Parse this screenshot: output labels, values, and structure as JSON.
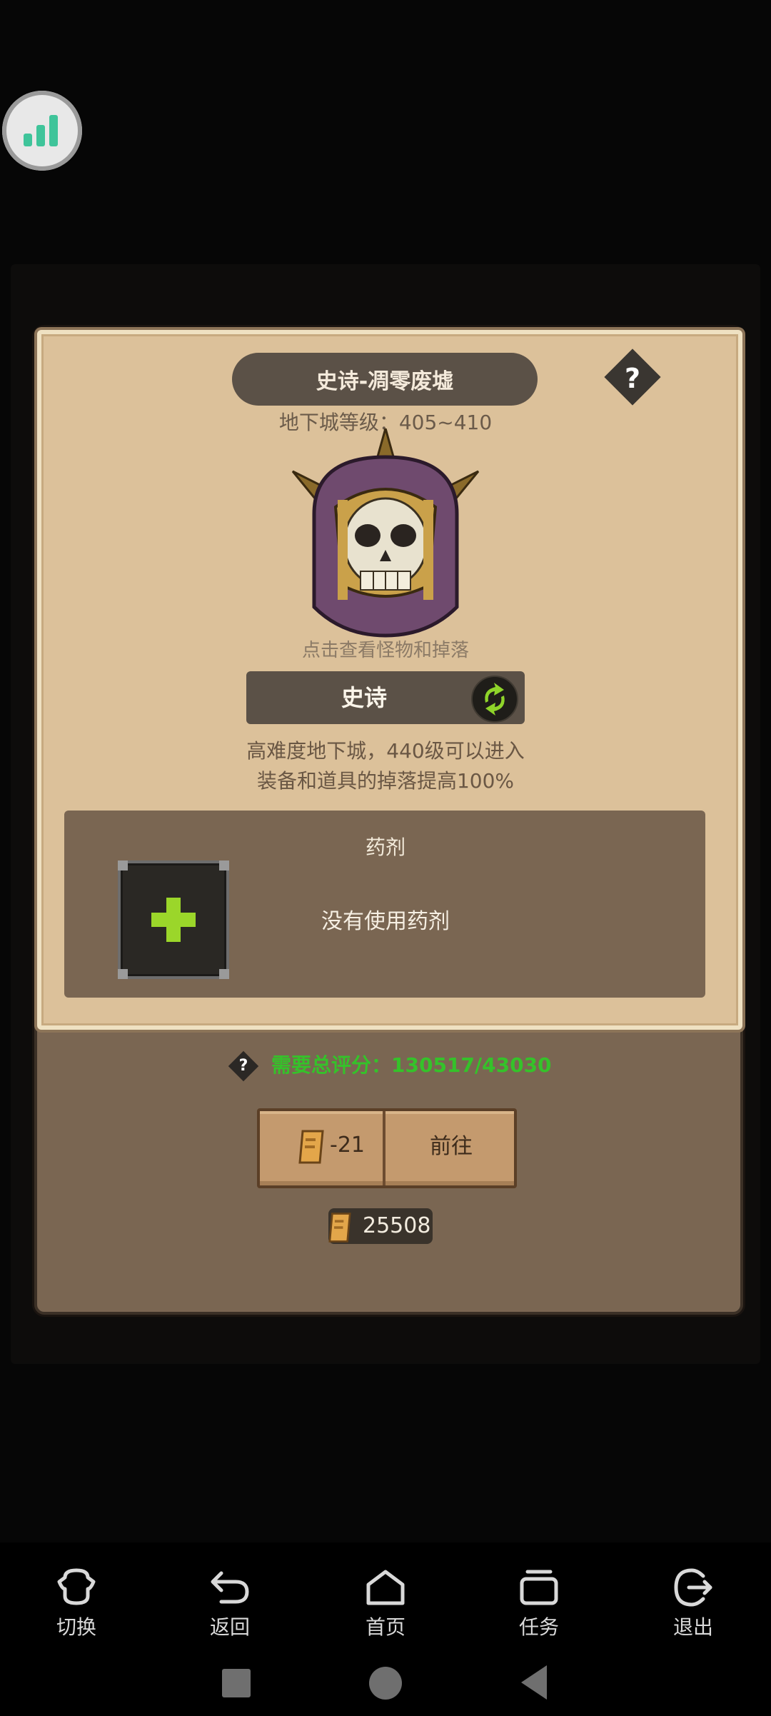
{
  "dungeon": {
    "title": "史诗-凋零废墟",
    "level_label": "地下城等级：405~410",
    "boss_hint": "点击查看怪物和掉落",
    "help_mark": "?"
  },
  "difficulty": {
    "label": "史诗",
    "desc_line1": "高难度地下城，440级可以进入",
    "desc_line2": "装备和道具的掉落提高100%"
  },
  "potion": {
    "title": "药剂",
    "empty_text": "没有使用药剂"
  },
  "requirement": {
    "help_mark": "?",
    "score_text": "需要总评分：130517/43030",
    "score_color": "#35c22a"
  },
  "action": {
    "cost": "-21",
    "go_label": "前往"
  },
  "tickets": {
    "count": "25508"
  },
  "bottom_nav": {
    "items": [
      {
        "label": "切换",
        "icon": "switch-icon"
      },
      {
        "label": "返回",
        "icon": "back-arrow-icon"
      },
      {
        "label": "首页",
        "icon": "home-icon"
      },
      {
        "label": "任务",
        "icon": "tasks-icon"
      },
      {
        "label": "退出",
        "icon": "exit-icon"
      }
    ]
  }
}
